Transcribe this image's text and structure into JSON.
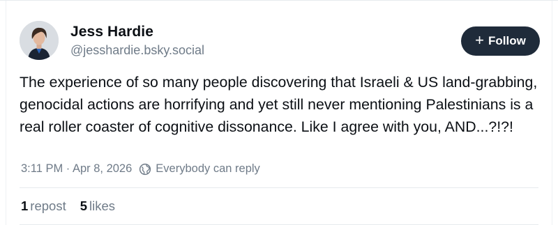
{
  "author": {
    "display_name": "Jess Hardie",
    "handle": "@jesshardie.bsky.social"
  },
  "follow_button": {
    "icon": "plus-icon",
    "label": "Follow"
  },
  "post": {
    "text": "The experience of so many people discovering that Israeli & US land-grabbing, genocidal actions are horrifying and yet still never mentioning Palestinians is a real roller coaster of cognitive dissonance. Like I agree with you, AND...?!?!"
  },
  "meta": {
    "timestamp": "3:11 PM · Apr 8, 2026",
    "reply_icon": "globe-icon",
    "reply_setting": "Everybody can reply"
  },
  "stats": {
    "reposts_count": "1",
    "reposts_label": "repost",
    "likes_count": "5",
    "likes_label": "likes"
  },
  "colors": {
    "button_bg": "#1f2b3a",
    "muted_text": "#6f7b88",
    "primary_text": "#0b0f14",
    "divider": "#e6eaee"
  }
}
